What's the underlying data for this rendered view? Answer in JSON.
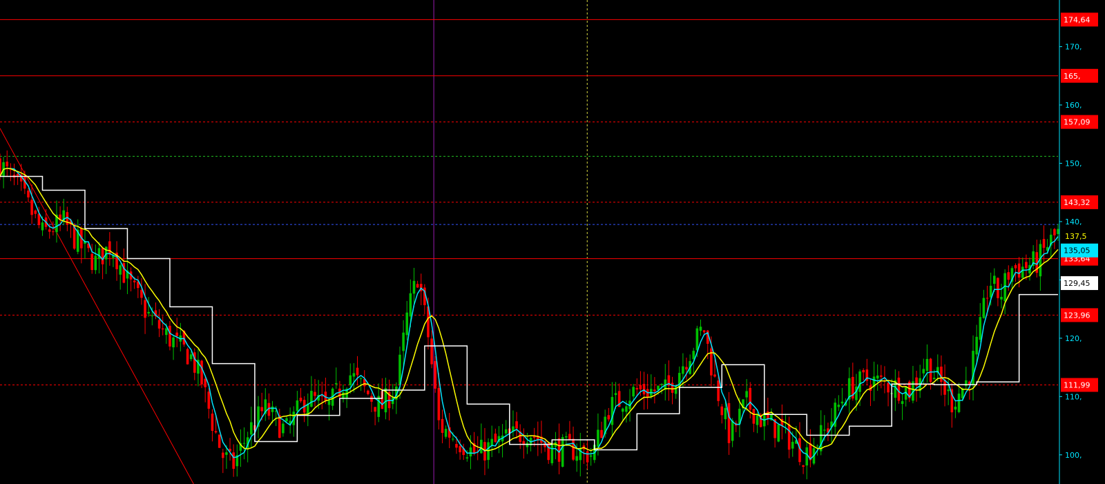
{
  "chart_data": {
    "type": "candlestick",
    "title": "",
    "xlabel": "",
    "ylabel": "",
    "ylim": [
      95,
      178
    ],
    "y_ticks": [
      {
        "value": 100,
        "label": "100,"
      },
      {
        "value": 110,
        "label": "110,"
      },
      {
        "value": 120,
        "label": "120,"
      },
      {
        "value": 130,
        "label": "130,"
      },
      {
        "value": 140,
        "label": "140,"
      },
      {
        "value": 150,
        "label": "150,"
      },
      {
        "value": 160,
        "label": "160,"
      },
      {
        "value": 170,
        "label": "170,"
      }
    ],
    "horizontal_levels": [
      {
        "value": 174.64,
        "label": "174,64",
        "style": "solid",
        "color": "#ff0000"
      },
      {
        "value": 165,
        "label": "165,",
        "style": "solid",
        "color": "#ff0000"
      },
      {
        "value": 157.09,
        "label": "157,09",
        "style": "dashed",
        "color": "#ff0000"
      },
      {
        "value": 151.2,
        "label": "",
        "style": "dashed",
        "color": "#22c022"
      },
      {
        "value": 143.32,
        "label": "143,32",
        "style": "dashed",
        "color": "#ff0000"
      },
      {
        "value": 139.5,
        "label": "",
        "style": "dashed",
        "color": "#3355ff"
      },
      {
        "value": 133.64,
        "label": "133,64",
        "style": "solid",
        "color": "#ff0000"
      },
      {
        "value": 123.96,
        "label": "123,96",
        "style": "dashed",
        "color": "#ff0000"
      },
      {
        "value": 111.99,
        "label": "111,99",
        "style": "dashed",
        "color": "#ff0000"
      }
    ],
    "last_value_tags": [
      {
        "value": 137.5,
        "label": "137,5",
        "series": "yellow"
      },
      {
        "value": 135.05,
        "label": "135,05",
        "series": "cyan"
      },
      {
        "value": 129.45,
        "label": "129,45",
        "series": "white"
      }
    ],
    "vertical_lines": [
      {
        "frac": 0.41,
        "color": "#9a1ab0",
        "style": "solid"
      },
      {
        "frac": 0.555,
        "color": "#d8d840",
        "style": "dashed"
      }
    ],
    "trendline": {
      "from": [
        0.0,
        156
      ],
      "to": [
        0.183,
        95
      ]
    },
    "price_path_anchors": [
      [
        0,
        150
      ],
      [
        0.02,
        145
      ],
      [
        0.04,
        138
      ],
      [
        0.06,
        140
      ],
      [
        0.075,
        136
      ],
      [
        0.09,
        133
      ],
      [
        0.105,
        136
      ],
      [
        0.12,
        130
      ],
      [
        0.14,
        124
      ],
      [
        0.16,
        120
      ],
      [
        0.18,
        117
      ],
      [
        0.19,
        113
      ],
      [
        0.2,
        106
      ],
      [
        0.21,
        100
      ],
      [
        0.22,
        98
      ],
      [
        0.235,
        104
      ],
      [
        0.25,
        108
      ],
      [
        0.27,
        104
      ],
      [
        0.29,
        110
      ],
      [
        0.31,
        108
      ],
      [
        0.33,
        114
      ],
      [
        0.345,
        111
      ],
      [
        0.36,
        108
      ],
      [
        0.375,
        112
      ],
      [
        0.385,
        124
      ],
      [
        0.395,
        131
      ],
      [
        0.405,
        120
      ],
      [
        0.415,
        105
      ],
      [
        0.43,
        103
      ],
      [
        0.45,
        100
      ],
      [
        0.48,
        103
      ],
      [
        0.5,
        104
      ],
      [
        0.52,
        101
      ],
      [
        0.54,
        101
      ],
      [
        0.56,
        100
      ],
      [
        0.575,
        108
      ],
      [
        0.6,
        111
      ],
      [
        0.63,
        111
      ],
      [
        0.65,
        117
      ],
      [
        0.665,
        122
      ],
      [
        0.675,
        113
      ],
      [
        0.69,
        103
      ],
      [
        0.705,
        109
      ],
      [
        0.72,
        106
      ],
      [
        0.74,
        104
      ],
      [
        0.76,
        100
      ],
      [
        0.78,
        104
      ],
      [
        0.8,
        111
      ],
      [
        0.82,
        113
      ],
      [
        0.84,
        112
      ],
      [
        0.86,
        111
      ],
      [
        0.875,
        116
      ],
      [
        0.89,
        112
      ],
      [
        0.9,
        109
      ],
      [
        0.915,
        113
      ],
      [
        0.925,
        120
      ],
      [
        0.935,
        130
      ],
      [
        0.945,
        127
      ],
      [
        0.955,
        132
      ],
      [
        0.965,
        132
      ],
      [
        0.98,
        133
      ],
      [
        0.99,
        136
      ],
      [
        1.0,
        138
      ]
    ],
    "moving_averages": [
      {
        "color": "#00e5ff",
        "period": 4
      },
      {
        "color": "#ffff00",
        "period": 10
      },
      {
        "color": "#ffffff",
        "period": 14,
        "stepped": true
      }
    ],
    "colors": {
      "background": "#000000",
      "up_candle": "#00c000",
      "down_candle": "#ff0000",
      "axis_line": "#00e5ff",
      "tick_text": "#00e5ff",
      "level_tag": "#ff0000",
      "level_tag_text": "#ffffff",
      "tag_cyan": "#00e5ff",
      "tag_yellow": "#ffff00",
      "tag_white": "#ffffff"
    }
  }
}
